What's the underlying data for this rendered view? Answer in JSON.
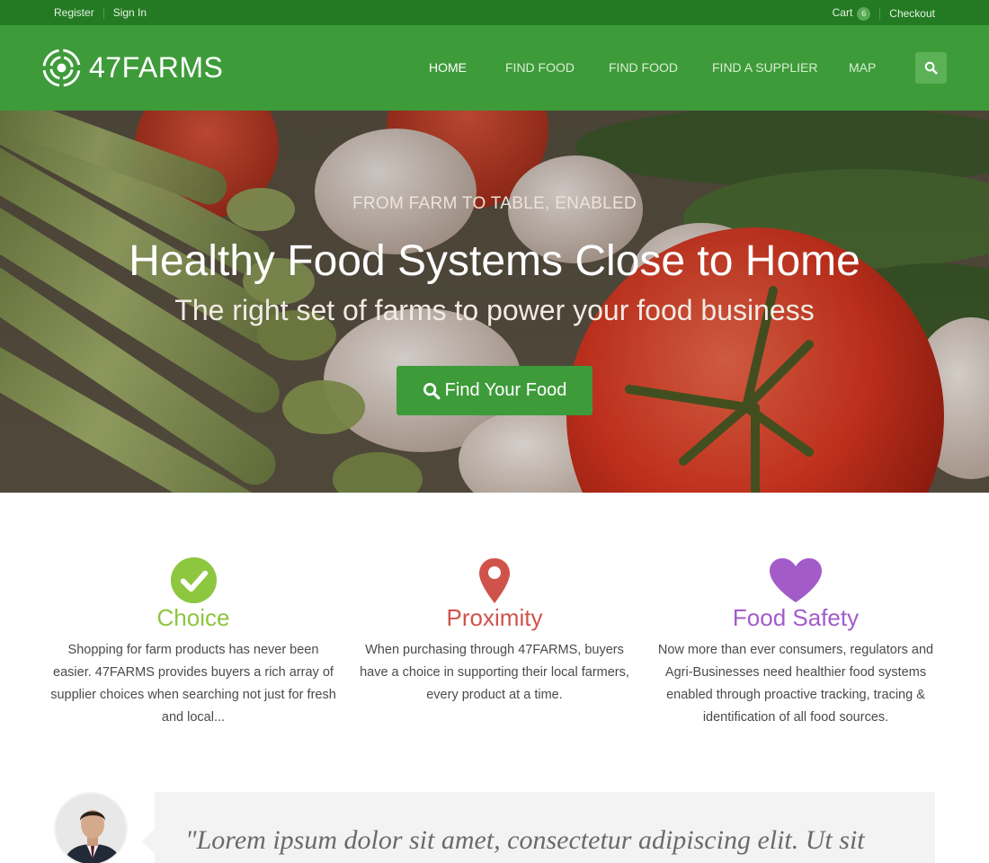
{
  "topbar": {
    "register": "Register",
    "signin": "Sign In",
    "cart_label": "Cart",
    "cart_count": "6",
    "checkout": "Checkout"
  },
  "header": {
    "brand": "47FARMS",
    "nav": [
      "HOME",
      "FIND FOOD",
      "FIND FOOD",
      "FIND A SUPPLIER",
      "MAP"
    ],
    "active_nav": "HOME"
  },
  "hero": {
    "kicker": "FROM FARM TO TABLE, ENABLED",
    "headline": "Healthy Food Systems Close to Home",
    "subline": "The right set of farms to power your food business",
    "cta": "Find Your Food"
  },
  "features": [
    {
      "title": "Choice",
      "icon": "check-circle-icon",
      "color": "#8dc63f",
      "desc": "Shopping for farm products has never been easier. 47FARMS provides buyers a rich array of supplier choices when searching not just for fresh and local..."
    },
    {
      "title": "Proximity",
      "icon": "map-pin-icon",
      "color": "#d0534b",
      "desc": "When purchasing through 47FARMS, buyers have a choice in supporting their local farmers, every product at a time."
    },
    {
      "title": "Food Safety",
      "icon": "heart-icon",
      "color": "#a25bc9",
      "desc": "Now more than ever consumers, regulators and Agri-Businesses need healthier food systems enabled through proactive tracking, tracing & identification of all food sources."
    }
  ],
  "testimonial": {
    "quote": "\"Lorem ipsum dolor sit amet, consectetur adipiscing elit. Ut sit"
  },
  "colors": {
    "topbar": "#237a23",
    "header": "#3e9b3a",
    "cta": "#3e9b3a"
  }
}
